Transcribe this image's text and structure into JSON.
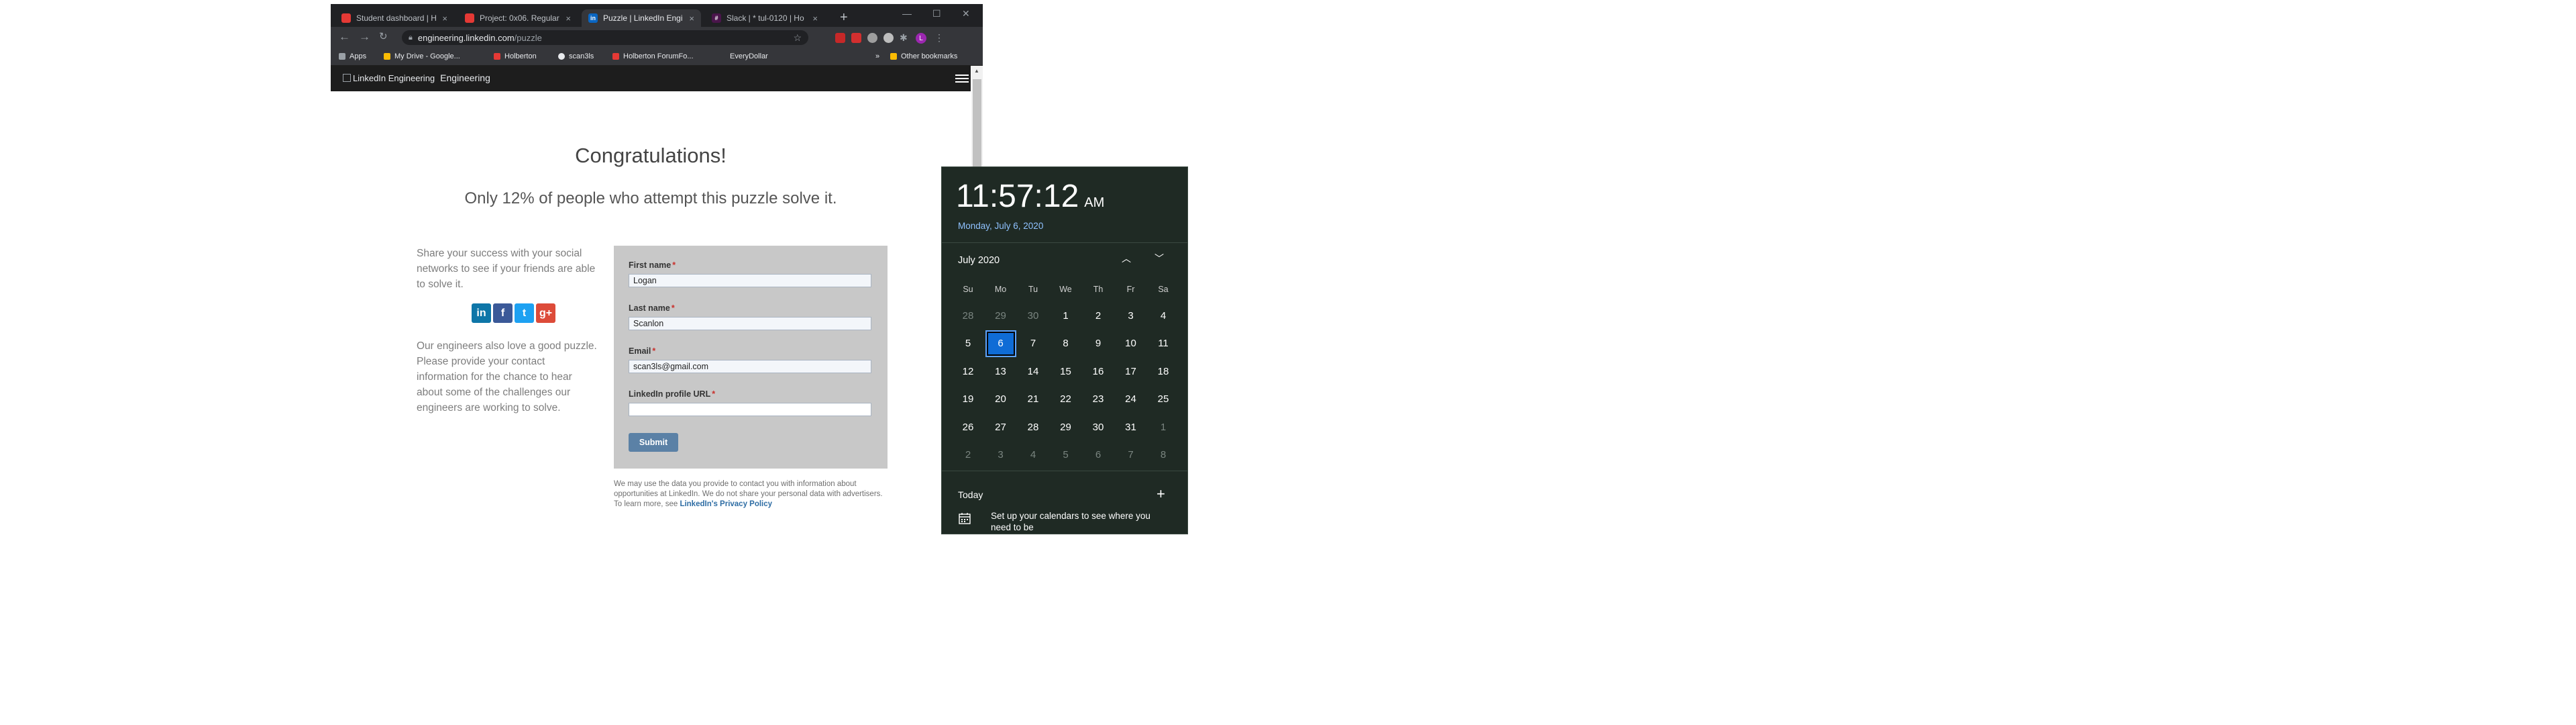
{
  "browser": {
    "tabs": [
      {
        "title": "Student dashboard | H",
        "icon_color": "#e53935",
        "icon_glyph": ""
      },
      {
        "title": "Project: 0x06. Regular",
        "icon_color": "#e53935",
        "icon_glyph": ""
      },
      {
        "title": "Puzzle | LinkedIn Engi",
        "icon_color": "#0a66c2",
        "icon_glyph": "in"
      },
      {
        "title": "Slack | * tul-0120 | Ho",
        "icon_color": "#4a154b",
        "icon_glyph": "#"
      }
    ],
    "active_tab_index": 2,
    "url_host": "engineering.linkedin.com",
    "url_path": "/puzzle",
    "bookmarks": [
      {
        "label": "Apps",
        "icon": "apps-grid-icon",
        "color": "#9aa0a6"
      },
      {
        "label": "My Drive - Google...",
        "icon": "google-drive-icon",
        "color": "#fbbc04"
      },
      {
        "label": "Holberton",
        "icon": "holberton-icon",
        "color": "#e53935"
      },
      {
        "label": "scan3ls",
        "icon": "github-icon",
        "color": "#e8eaed"
      },
      {
        "label": "Holberton ForumFo...",
        "icon": "holberton-icon",
        "color": "#e53935"
      },
      {
        "label": "EveryDollar",
        "icon": "blank-page-icon",
        "color": "#35363a"
      }
    ],
    "overflow_chevron": "»",
    "other_bookmarks": "Other bookmarks"
  },
  "page": {
    "logo_alt": "LinkedIn Engineering",
    "logo_text": "Engineering",
    "headline": "Congratulations!",
    "subheadline": "Only 12% of people who attempt this puzzle solve it.",
    "share_text": "Share your success with your social networks to see if your friends are able to solve it.",
    "social": [
      {
        "name": "linkedin",
        "glyph": "in",
        "color": "#0e76a8"
      },
      {
        "name": "facebook",
        "glyph": "f",
        "color": "#3b5998"
      },
      {
        "name": "twitter",
        "glyph": "t",
        "color": "#1da1f2"
      },
      {
        "name": "google-plus",
        "glyph": "g+",
        "color": "#dd4b39"
      }
    ],
    "engineers_text": "Our engineers also love a good puzzle. Please provide your contact information for the chance to hear about some of the challenges our engineers are working to solve.",
    "form": {
      "first_name_label": "First name",
      "first_name_value": "Logan",
      "last_name_label": "Last name",
      "last_name_value": "Scanlon",
      "email_label": "Email",
      "email_value": "scan3ls@gmail.com",
      "profile_label": "LinkedIn profile URL",
      "profile_value": "",
      "required_mark": "*",
      "submit_label": "Submit"
    },
    "disclaimer_text": "We may use the data you provide to contact you with information about opportunities at LinkedIn. We do not share your personal data with advertisers. To learn more, see ",
    "privacy_link": "LinkedIn's Privacy Policy"
  },
  "flyout": {
    "time": "11:57:12",
    "ampm": "AM",
    "long_date": "Monday, July 6, 2020",
    "month_label": "July 2020",
    "weekdays": [
      "Su",
      "Mo",
      "Tu",
      "We",
      "Th",
      "Fr",
      "Sa"
    ],
    "weeks": [
      [
        "28",
        "29",
        "30",
        "1",
        "2",
        "3",
        "4"
      ],
      [
        "5",
        "6",
        "7",
        "8",
        "9",
        "10",
        "11"
      ],
      [
        "12",
        "13",
        "14",
        "15",
        "16",
        "17",
        "18"
      ],
      [
        "19",
        "20",
        "21",
        "22",
        "23",
        "24",
        "25"
      ],
      [
        "26",
        "27",
        "28",
        "29",
        "30",
        "31",
        "1"
      ],
      [
        "2",
        "3",
        "4",
        "5",
        "6",
        "7",
        "8"
      ]
    ],
    "selected_day": "6",
    "today_label": "Today",
    "setup_text": "Set up your calendars to see where you need to be"
  }
}
